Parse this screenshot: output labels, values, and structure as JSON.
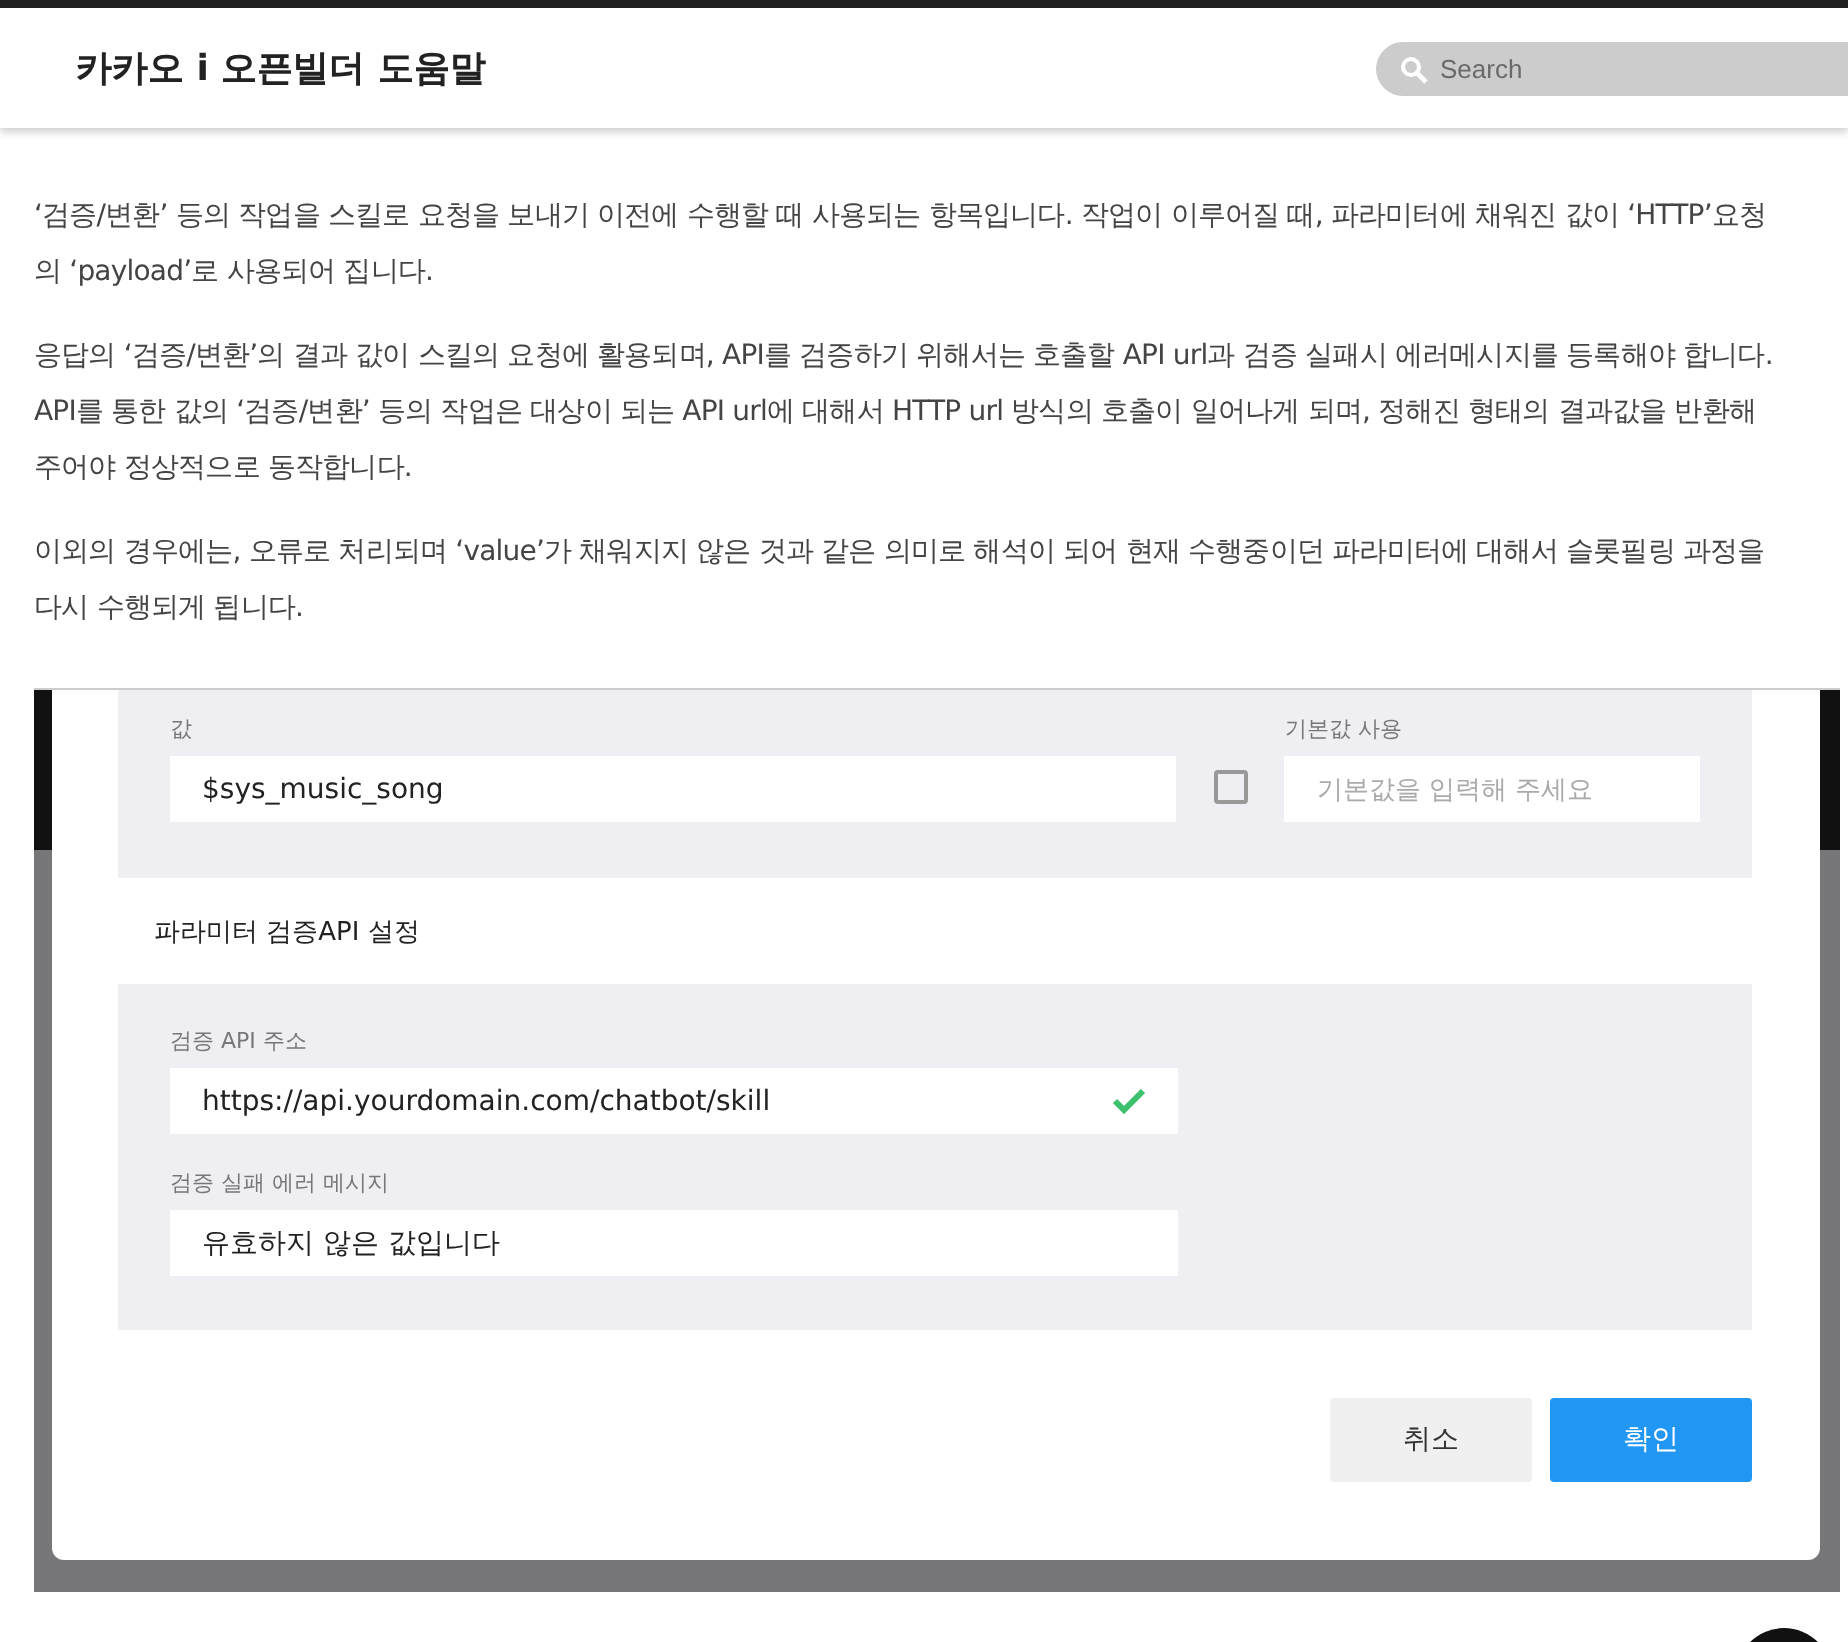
{
  "header": {
    "title": "카카오 i 오픈빌더 도움말",
    "search": {
      "placeholder": "Search"
    }
  },
  "paragraphs": [
    "‘검증/변환’ 등의 작업을 스킬로 요청을 보내기 이전에 수행할 때 사용되는 항목입니다. 작업이 이루어질 때, 파라미터에 채워진 값이 ‘HTTP’요청의 ‘payload’로 사용되어 집니다.",
    "응답의 ‘검증/변환’의 결과 값이 스킬의 요청에 활용되며, API를 검증하기 위해서는 호출할 API url과 검증 실패시 에러메시지를 등록해야 합니다. API를 통한 값의 ‘검증/변환’ 등의 작업은 대상이 되는 API url에 대해서 HTTP url 방식의 호출이 일어나게 되며, 정해진 형태의 결과값을 반환해주어야 정상적으로 동작합니다.",
    "이외의 경우에는, 오류로 처리되며 ‘value’가 채워지지 않은 것과 같은 의미로 해석이 되어 현재 수행중이던 파라미터에 대해서 슬롯필링 과정을 다시 수행되게 됩니다."
  ],
  "dialog": {
    "value_field": {
      "label": "값",
      "value": "$sys_music_song"
    },
    "default_field": {
      "label": "기본값 사용",
      "checked": false,
      "placeholder": "기본값을 입력해 주세요"
    },
    "section_title": "파라미터  검증API 설정",
    "api_url_field": {
      "label": "검증 API 주소",
      "value": "https://api.yourdomain.com/chatbot/skill",
      "valid": true
    },
    "error_field": {
      "label": "검증 실패 에러 메시지",
      "value": "유효하지 않은 값입니다"
    },
    "buttons": [
      {
        "label": "취소",
        "kind": "secondary"
      },
      {
        "label": "확인",
        "kind": "primary"
      }
    ]
  }
}
